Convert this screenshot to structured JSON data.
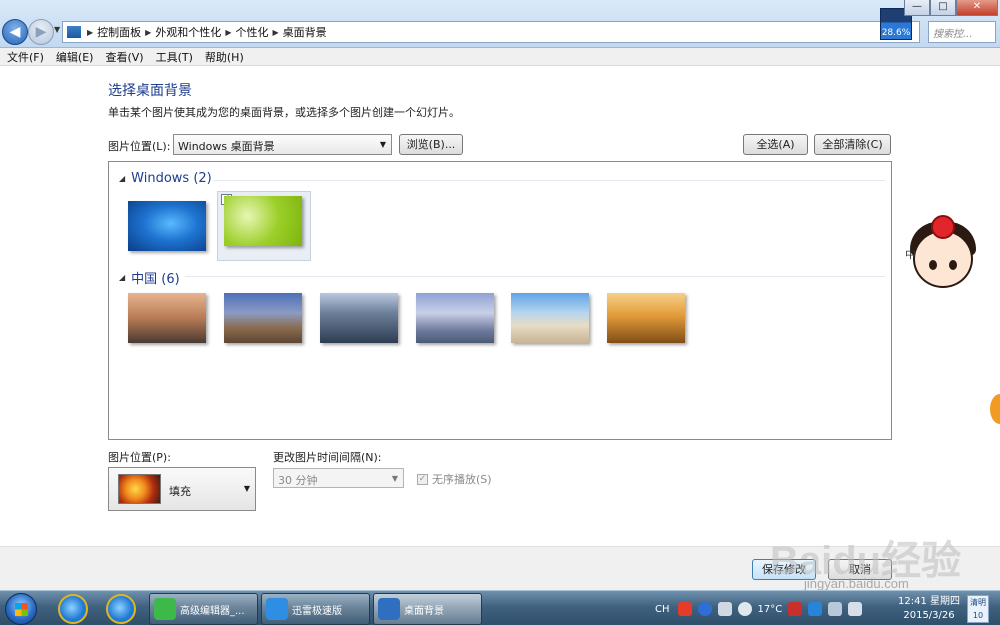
{
  "window": {
    "breadcrumb": [
      "控制面板",
      "外观和个性化",
      "个性化",
      "桌面背景"
    ],
    "search_placeholder": "搜索控...",
    "perf_percent": "28.6%",
    "controls": {
      "minimize": "—",
      "maximize": "□",
      "close": "✕"
    }
  },
  "menu": [
    "文件(F)",
    "编辑(E)",
    "查看(V)",
    "工具(T)",
    "帮助(H)"
  ],
  "main": {
    "title": "选择桌面背景",
    "description": "单击某个图片使其成为您的桌面背景，或选择多个图片创建一个幻灯片。",
    "location_label": "图片位置(L):",
    "location_value": "Windows 桌面背景",
    "browse_label": "浏览(B)...",
    "select_all_label": "全选(A)",
    "clear_all_label": "全部清除(C)"
  },
  "gallery": {
    "groups": [
      {
        "name": "Windows (2)",
        "thumbs": 2,
        "selected_index": 1
      },
      {
        "name": "中国 (6)",
        "thumbs": 6
      }
    ]
  },
  "options": {
    "position_label": "图片位置(P):",
    "position_value": "填充",
    "interval_label": "更改图片时间间隔(N):",
    "interval_value": "30 分钟",
    "shuffle_label": "无序播放(S)"
  },
  "footer": {
    "save_label": "保存修改",
    "cancel_label": "取消"
  },
  "mascot_text": "中",
  "watermark": {
    "brand": "Baidu经验",
    "url": "jingyan.baidu.com"
  },
  "taskbar": {
    "apps": [
      "高级编辑器_...",
      "迅雷极速版",
      "桌面背景"
    ],
    "lang": "CH",
    "temperature": "17°C",
    "time": "12:41 星期四",
    "date": "2015/3/26",
    "weather_label": "清明",
    "weather_num": "10"
  },
  "colors": {
    "accent_title": "#1e3d8f",
    "taskbar": "#41627f"
  }
}
